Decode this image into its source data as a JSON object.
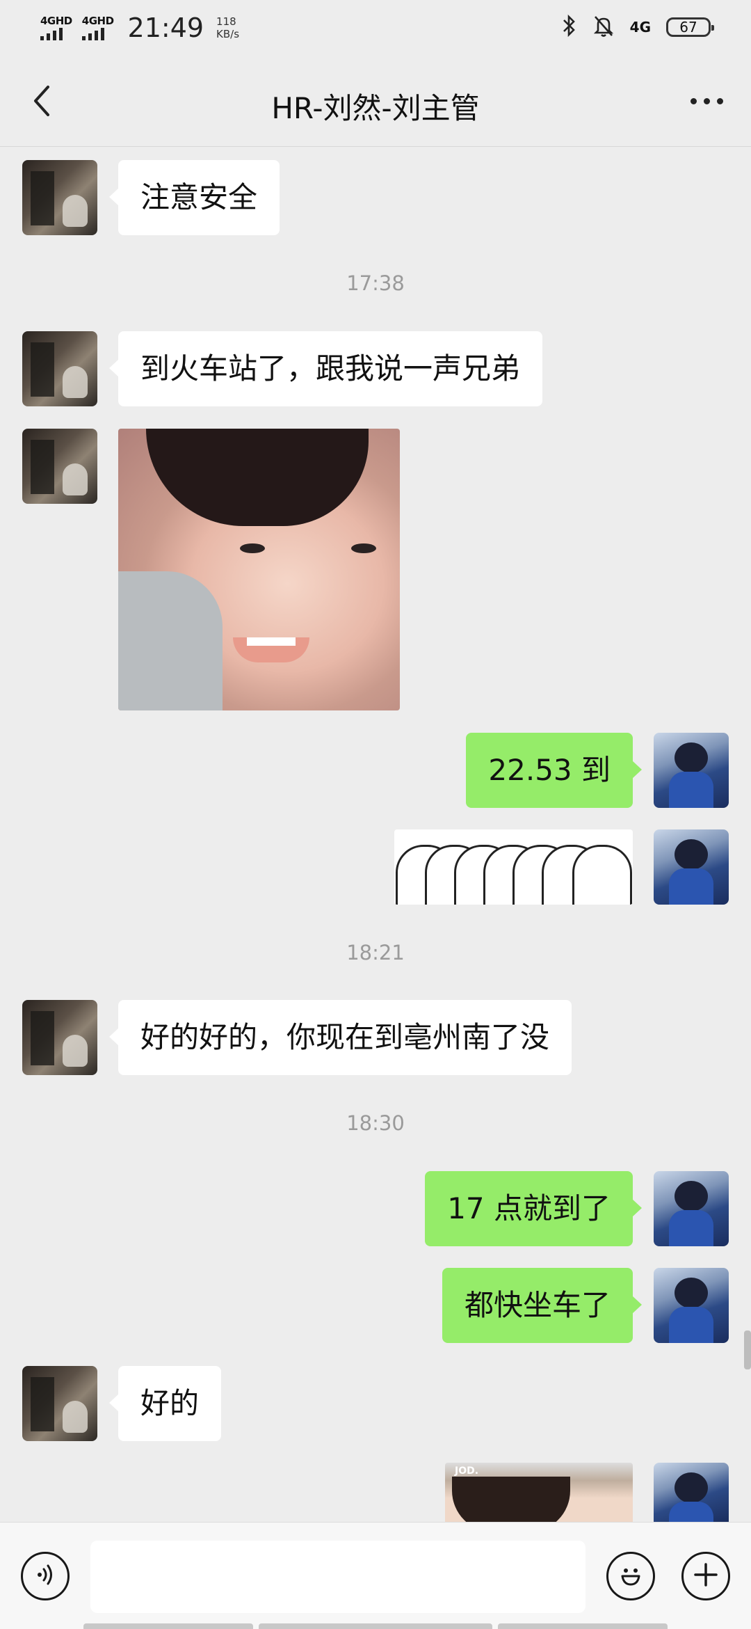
{
  "status_bar": {
    "signal1": "4GHD",
    "signal2": "4GHD",
    "time": "21:49",
    "net_speed_value": "118",
    "net_speed_unit": "KB/s",
    "network_right": "4G",
    "battery": "67"
  },
  "header": {
    "title": "HR-刘然-刘主管"
  },
  "messages": {
    "m1": "注意安全",
    "t1": "17:38",
    "m2": "到火车站了，跟我说一声兄弟",
    "m4": "22.53 到",
    "t2": "18:21",
    "m6": "好的好的，你现在到亳州南了没",
    "t3": "18:30",
    "m7": "17 点就到了",
    "m8": "都快坐车了",
    "m9": "好的",
    "m10_sticker_text": "JOD."
  },
  "input": {
    "placeholder": ""
  },
  "icons": {
    "back": "chevron-left-icon",
    "more": "more-dots-icon",
    "voice": "voice-icon",
    "emoji": "emoji-icon",
    "plus": "plus-icon"
  },
  "colors": {
    "background": "#ededed",
    "bubble_self": "#95ec69",
    "bubble_other": "#ffffff",
    "timestamp": "#9a9a9a"
  }
}
